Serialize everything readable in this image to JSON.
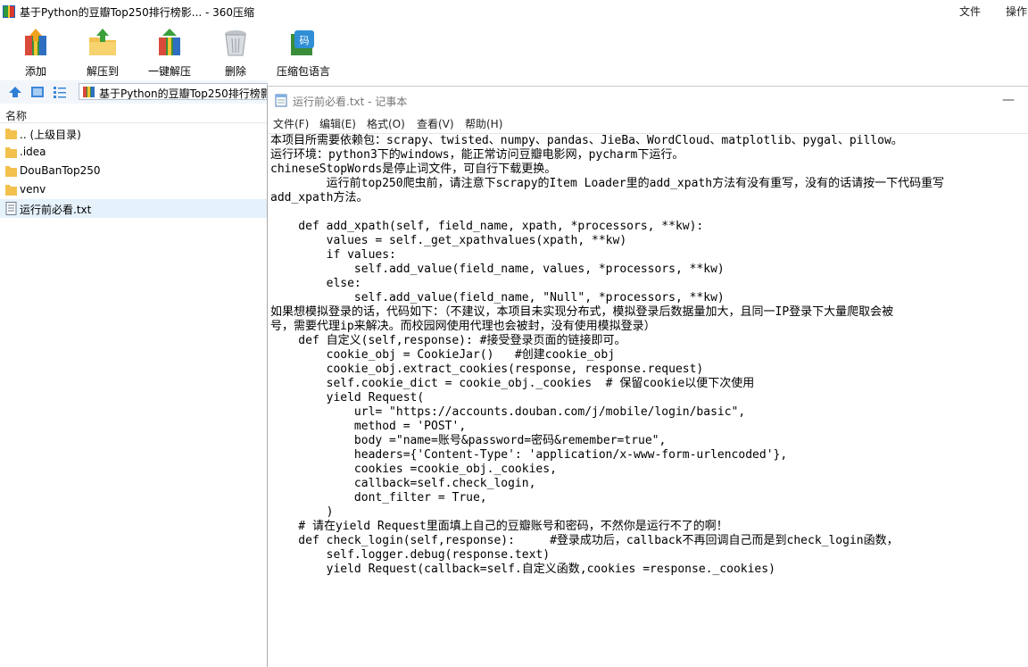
{
  "app": {
    "title": "基于Python的豆瓣Top250排行榜影... - 360压缩",
    "menu": [
      "文件",
      "操作"
    ]
  },
  "toolbar": {
    "buttons": [
      {
        "label": "添加",
        "icon": "add-archive-icon"
      },
      {
        "label": "解压到",
        "icon": "extract-folder-icon"
      },
      {
        "label": "一键解压",
        "icon": "one-click-extract-icon"
      },
      {
        "label": "删除",
        "icon": "trash-can-icon"
      },
      {
        "label": "压缩包语言",
        "icon": "archive-language-icon"
      }
    ]
  },
  "nav": {
    "address": "基于Python的豆瓣Top250排行榜影"
  },
  "file_list": {
    "column_name": "名称",
    "items": [
      {
        "name": ".. (上级目录)",
        "type": "folder"
      },
      {
        "name": ".idea",
        "type": "folder"
      },
      {
        "name": "DouBanTop250",
        "type": "folder"
      },
      {
        "name": "venv",
        "type": "folder"
      },
      {
        "name": "运行前必看.txt",
        "type": "text-file",
        "selected": true
      }
    ]
  },
  "notepad": {
    "title": "运行前必看.txt - 记事本",
    "minimize": "—",
    "menu": [
      "文件(F)",
      "编辑(E)",
      "格式(O)",
      "查看(V)",
      "帮助(H)"
    ],
    "content": "本项目所需要依赖包：scrapy、twisted、numpy、pandas、JieBa、WordCloud、matplotlib、pygal、pillow。\n运行环境：python3下的windows，能正常访问豆瓣电影网，pycharm下运行。\nchineseStopWords是停止词文件，可自行下载更换。\n        运行前top250爬虫前，请注意下scrapy的Item Loader里的add_xpath方法有没有重写，没有的话请按一下代码重写\nadd_xpath方法。\n\n    def add_xpath(self, field_name, xpath, *processors, **kw):\n        values = self._get_xpathvalues(xpath, **kw)\n        if values:\n            self.add_value(field_name, values, *processors, **kw)\n        else:\n            self.add_value(field_name, \"Null\", *processors, **kw)\n如果想模拟登录的话，代码如下：（不建议，本项目未实现分布式，模拟登录后数据量加大，且同一IP登录下大量爬取会被\n号，需要代理ip来解决。而校园网使用代理也会被封，没有使用模拟登录）\n    def 自定义(self,response): #接受登录页面的链接即可。\n        cookie_obj = CookieJar()   #创建cookie_obj\n        cookie_obj.extract_cookies(response, response.request)\n        self.cookie_dict = cookie_obj._cookies  # 保留cookie以便下次使用\n        yield Request(\n            url= \"https://accounts.douban.com/j/mobile/login/basic\",\n            method = 'POST',\n            body =\"name=账号&password=密码&remember=true\",\n            headers={'Content-Type': 'application/x-www-form-urlencoded'},\n            cookies =cookie_obj._cookies,\n            callback=self.check_login,\n            dont_filter = True,\n        )\n    # 请在yield Request里面填上自己的豆瓣账号和密码，不然你是运行不了的啊！\n    def check_login(self,response):     #登录成功后，callback不再回调自己而是到check_login函数，\n        self.logger.debug(response.text)\n        yield Request(callback=self.自定义函数,cookies =response._cookies)"
  }
}
